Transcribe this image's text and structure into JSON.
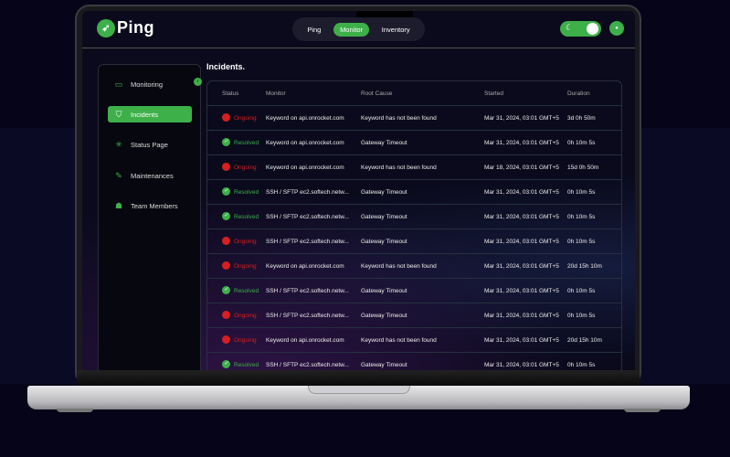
{
  "app": {
    "logo_text": "Ping"
  },
  "nav": {
    "items": [
      "Ping",
      "Monitor",
      "Inventory"
    ],
    "active": "Monitor"
  },
  "theme_toggle": {
    "icon": "moon-icon",
    "state": "on"
  },
  "colors": {
    "accent": "#3db049",
    "ongoing": "#d42020",
    "background": "#050418"
  },
  "sidebar": {
    "items": [
      {
        "label": "Monitoring",
        "icon": "monitor-icon"
      },
      {
        "label": "Incidents",
        "icon": "shield-icon",
        "active": true
      },
      {
        "label": "Status Page",
        "icon": "status-icon"
      },
      {
        "label": "Maintenances",
        "icon": "wrench-icon"
      },
      {
        "label": "Team Members",
        "icon": "team-icon"
      }
    ]
  },
  "page": {
    "title": "Incidents."
  },
  "table": {
    "headers": [
      "Status",
      "Monitor",
      "Root Cause",
      "Started",
      "Duration"
    ],
    "rows": [
      {
        "status": "Ongoing",
        "monitor": "Keyword on api.onrocket.com",
        "cause": "Keyword has not been found",
        "started": "Mar 31, 2024, 03:01 GMT+5",
        "duration": "3d 0h 50m"
      },
      {
        "status": "Resolved",
        "monitor": "Keyword on api.onrocket.com",
        "cause": "Gateway Timeout",
        "started": "Mar 31, 2024, 03:01 GMT+5",
        "duration": "0h 10m 5s"
      },
      {
        "status": "Ongoing",
        "monitor": "Keyword on api.onrocket.com",
        "cause": "Keyword has not been found",
        "started": "Mar 18, 2024, 03:01 GMT+5",
        "duration": "15d 0h 50m"
      },
      {
        "status": "Resolved",
        "monitor": "SSH / SFTP ec2.softech.netw...",
        "cause": "Gateway Timeout",
        "started": "Mar 31, 2024, 03:01 GMT+5",
        "duration": "0h 10m 5s"
      },
      {
        "status": "Resolved",
        "monitor": "SSH / SFTP ec2.softech.netw...",
        "cause": "Gateway Timeout",
        "started": "Mar 31, 2024, 03:01 GMT+5",
        "duration": "0h 10m 5s"
      },
      {
        "status": "Ongoing",
        "monitor": "SSH / SFTP ec2.softech.netw...",
        "cause": "Gateway Timeout",
        "started": "Mar 31, 2024, 03:01 GMT+5",
        "duration": "0h 10m 5s"
      },
      {
        "status": "Ongoing",
        "monitor": "Keyword on api.onrocket.com",
        "cause": "Keyword has not been found",
        "started": "Mar 31, 2024, 03:01 GMT+5",
        "duration": "20d 15h 10m"
      },
      {
        "status": "Resolved",
        "monitor": "SSH / SFTP ec2.softech.netw...",
        "cause": "Gateway Timeout",
        "started": "Mar 31, 2024, 03:01 GMT+5",
        "duration": "0h 10m 5s"
      },
      {
        "status": "Ongoing",
        "monitor": "SSH / SFTP ec2.softech.netw...",
        "cause": "Gateway Timeout",
        "started": "Mar 31, 2024, 03:01 GMT+5",
        "duration": "0h 10m 5s"
      },
      {
        "status": "Ongoing",
        "monitor": "Keyword on api.onrocket.com",
        "cause": "Keyword has not been found",
        "started": "Mar 31, 2024, 03:01 GMT+5",
        "duration": "20d 15h 10m"
      },
      {
        "status": "Resolved",
        "monitor": "SSH / SFTP ec2.softech.netw...",
        "cause": "Gateway Timeout",
        "started": "Mar 31, 2024, 03:01 GMT+5",
        "duration": "0h 10m 5s"
      }
    ]
  }
}
